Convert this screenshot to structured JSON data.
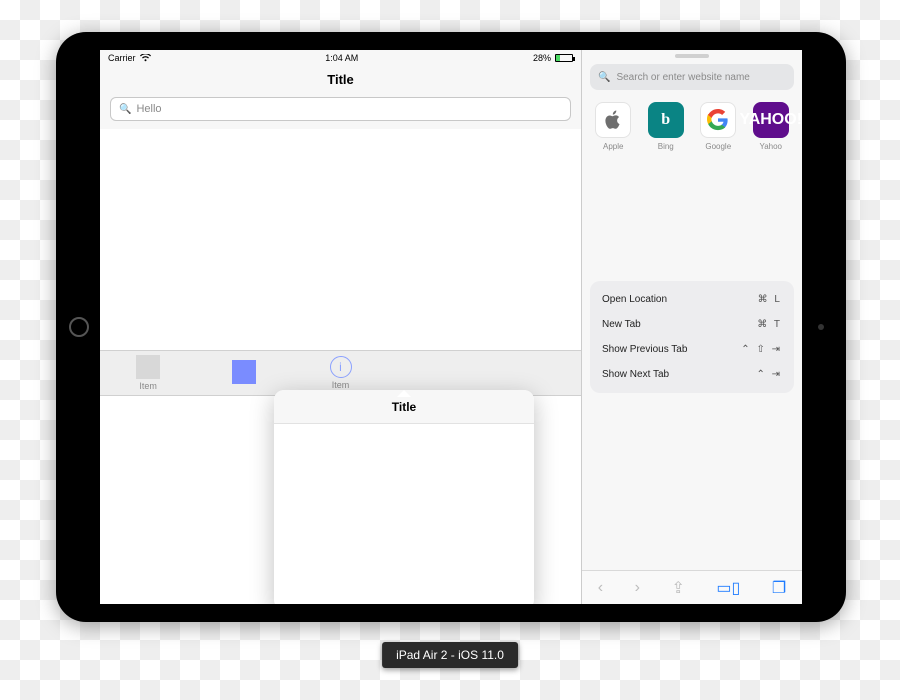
{
  "device_label": "iPad Air 2 - iOS 11.0",
  "status": {
    "carrier": "Carrier",
    "time": "1:04 AM",
    "battery_pct": "28%"
  },
  "left_app": {
    "nav_title": "Title",
    "search_placeholder": "Hello",
    "tabs": [
      {
        "label": "Item",
        "kind": "square"
      },
      {
        "label": "",
        "kind": "square-selected"
      },
      {
        "label": "Item",
        "kind": "info"
      },
      {
        "label": "",
        "kind": "empty"
      },
      {
        "label": "",
        "kind": "empty"
      }
    ],
    "popover_title": "Title"
  },
  "safari": {
    "address_placeholder": "Search or enter website name",
    "favorites": [
      {
        "label": "Apple",
        "glyph": ""
      },
      {
        "label": "Bing",
        "glyph": "b"
      },
      {
        "label": "Google",
        "glyph": "G"
      },
      {
        "label": "Yahoo",
        "glyph": "YAHOO!"
      }
    ],
    "commands": [
      {
        "label": "Open Location",
        "shortcut": "⌘ L"
      },
      {
        "label": "New Tab",
        "shortcut": "⌘ T"
      },
      {
        "label": "Show Previous Tab",
        "shortcut": "⌃ ⇧ ⇥"
      },
      {
        "label": "Show Next Tab",
        "shortcut": "⌃   ⇥"
      }
    ]
  }
}
